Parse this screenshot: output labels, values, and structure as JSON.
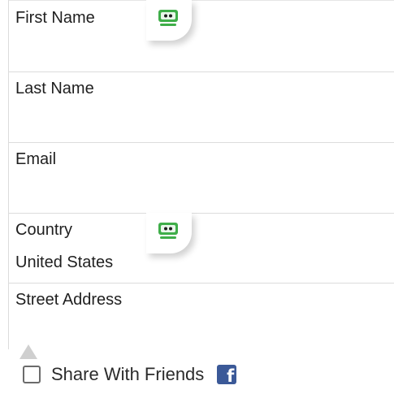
{
  "form": {
    "fields": [
      {
        "label": "First Name",
        "value": "",
        "has_helper": true
      },
      {
        "label": "Last Name",
        "value": ""
      },
      {
        "label": "Email",
        "value": ""
      },
      {
        "label": "Country",
        "value": "United States",
        "has_helper": true
      },
      {
        "label": "Street Address",
        "value": ""
      }
    ]
  },
  "share": {
    "label": "Share With Friends",
    "checked": false,
    "icon": "facebook-icon",
    "icon_color": "#3b5998"
  },
  "helper": {
    "icon": "robot-face-icon",
    "icon_color": "#3fae49"
  }
}
